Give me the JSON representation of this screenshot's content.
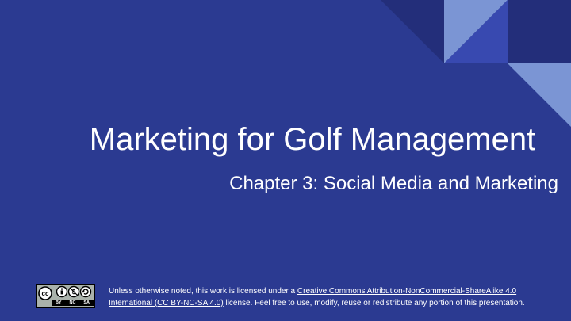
{
  "slide": {
    "title": "Marketing for Golf Management",
    "subtitle": "Chapter 3: Social Media and Marketing"
  },
  "license": {
    "badge": {
      "labels": [
        "BY",
        "NC",
        "SA"
      ]
    },
    "text_prefix": "Unless otherwise noted, this work is licensed under a ",
    "link_text": "Creative Commons Attribution-NonCommercial-ShareAlike 4.0 International (CC BY-NC-SA 4.0)",
    "text_suffix": " license. Feel free to use, modify, reuse or redistribute any portion of this presentation."
  },
  "colors": {
    "background": "#2b3a91",
    "accent_dark": "#232e7a",
    "accent_mid": "#3849b0",
    "accent_light": "#7b95d4",
    "text": "#ffffff"
  }
}
